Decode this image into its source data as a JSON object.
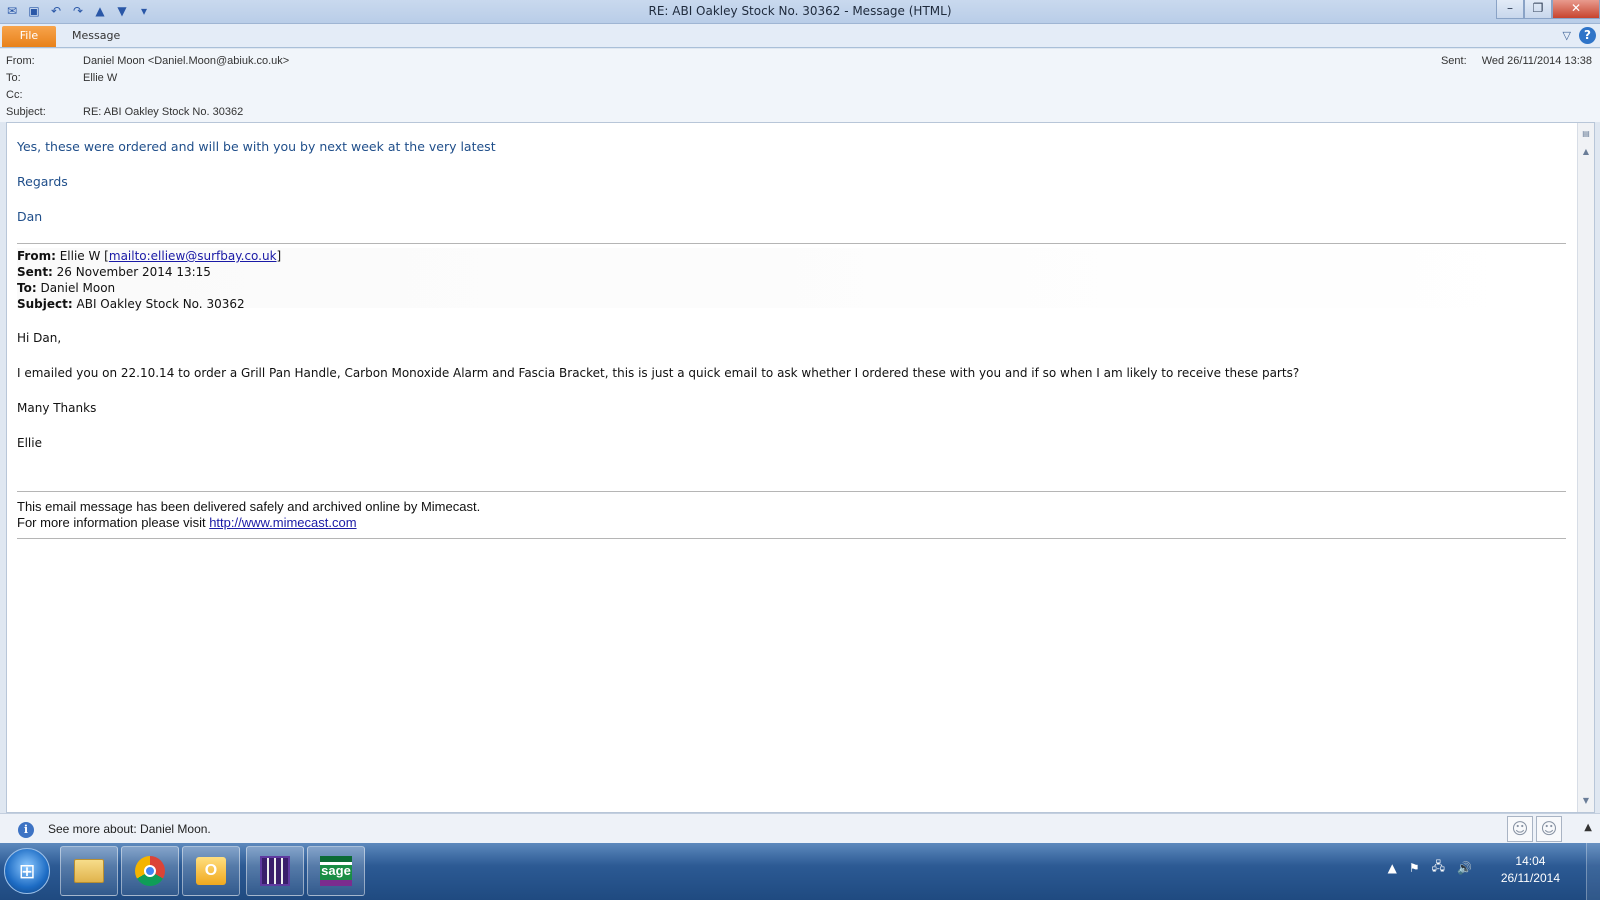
{
  "window": {
    "title": "RE: ABI Oakley Stock No. 30362  -  Message (HTML)",
    "minimize": "–",
    "restore": "❐",
    "close": "✕"
  },
  "qat": {
    "icons": [
      "envelope-icon",
      "save-icon",
      "undo-icon",
      "redo-icon",
      "previous-item-icon",
      "next-item-icon",
      "customize-icon"
    ]
  },
  "ribbon": {
    "file_label": "File",
    "message_label": "Message",
    "help_label": "?"
  },
  "headers": {
    "from_label": "From:",
    "from_value": "Daniel Moon <Daniel.Moon@abiuk.co.uk>",
    "to_label": "To:",
    "to_value": "Ellie W",
    "cc_label": "Cc:",
    "cc_value": "",
    "subject_label": "Subject:",
    "subject_value": "RE: ABI Oakley Stock No. 30362",
    "sent_label": "Sent:",
    "sent_value": "Wed 26/11/2014 13:38"
  },
  "reply": {
    "line1": "Yes, these were ordered and will be with you by next week at the very latest",
    "regards": "Regards",
    "signature": "Dan"
  },
  "original": {
    "from_label": "From:",
    "from_name": " Ellie W [",
    "from_link": "mailto:elliew@surfbay.co.uk",
    "from_close": "]",
    "sent_label": "Sent:",
    "sent_value": " 26 November 2014 13:15",
    "to_label": "To:",
    "to_value": " Daniel Moon",
    "subject_label": "Subject:",
    "subject_value": " ABI Oakley Stock No. 30362",
    "greeting": "Hi Dan,",
    "body": "I emailed you on 22.10.14 to order a Grill Pan Handle, Carbon Monoxide Alarm and Fascia Bracket, this is just a quick email to ask whether I ordered these with you and if so when I am likely to receive these parts?",
    "thanks": "Many Thanks",
    "signature": "Ellie"
  },
  "disclaimer": {
    "line1": "This email message has been delivered safely and archived online by Mimecast.",
    "line2_prefix": "For more information please visit ",
    "link": "http://www.mimecast.com"
  },
  "people_pane": {
    "text": "See more about: Daniel Moon.",
    "info_icon": "i"
  },
  "taskbar": {
    "apps": [
      "windows-explorer",
      "google-chrome",
      "microsoft-outlook",
      "calendar-app",
      "sage"
    ],
    "sage_label": "sage",
    "outlook_label": "O",
    "time": "14:04",
    "date": "26/11/2014"
  }
}
